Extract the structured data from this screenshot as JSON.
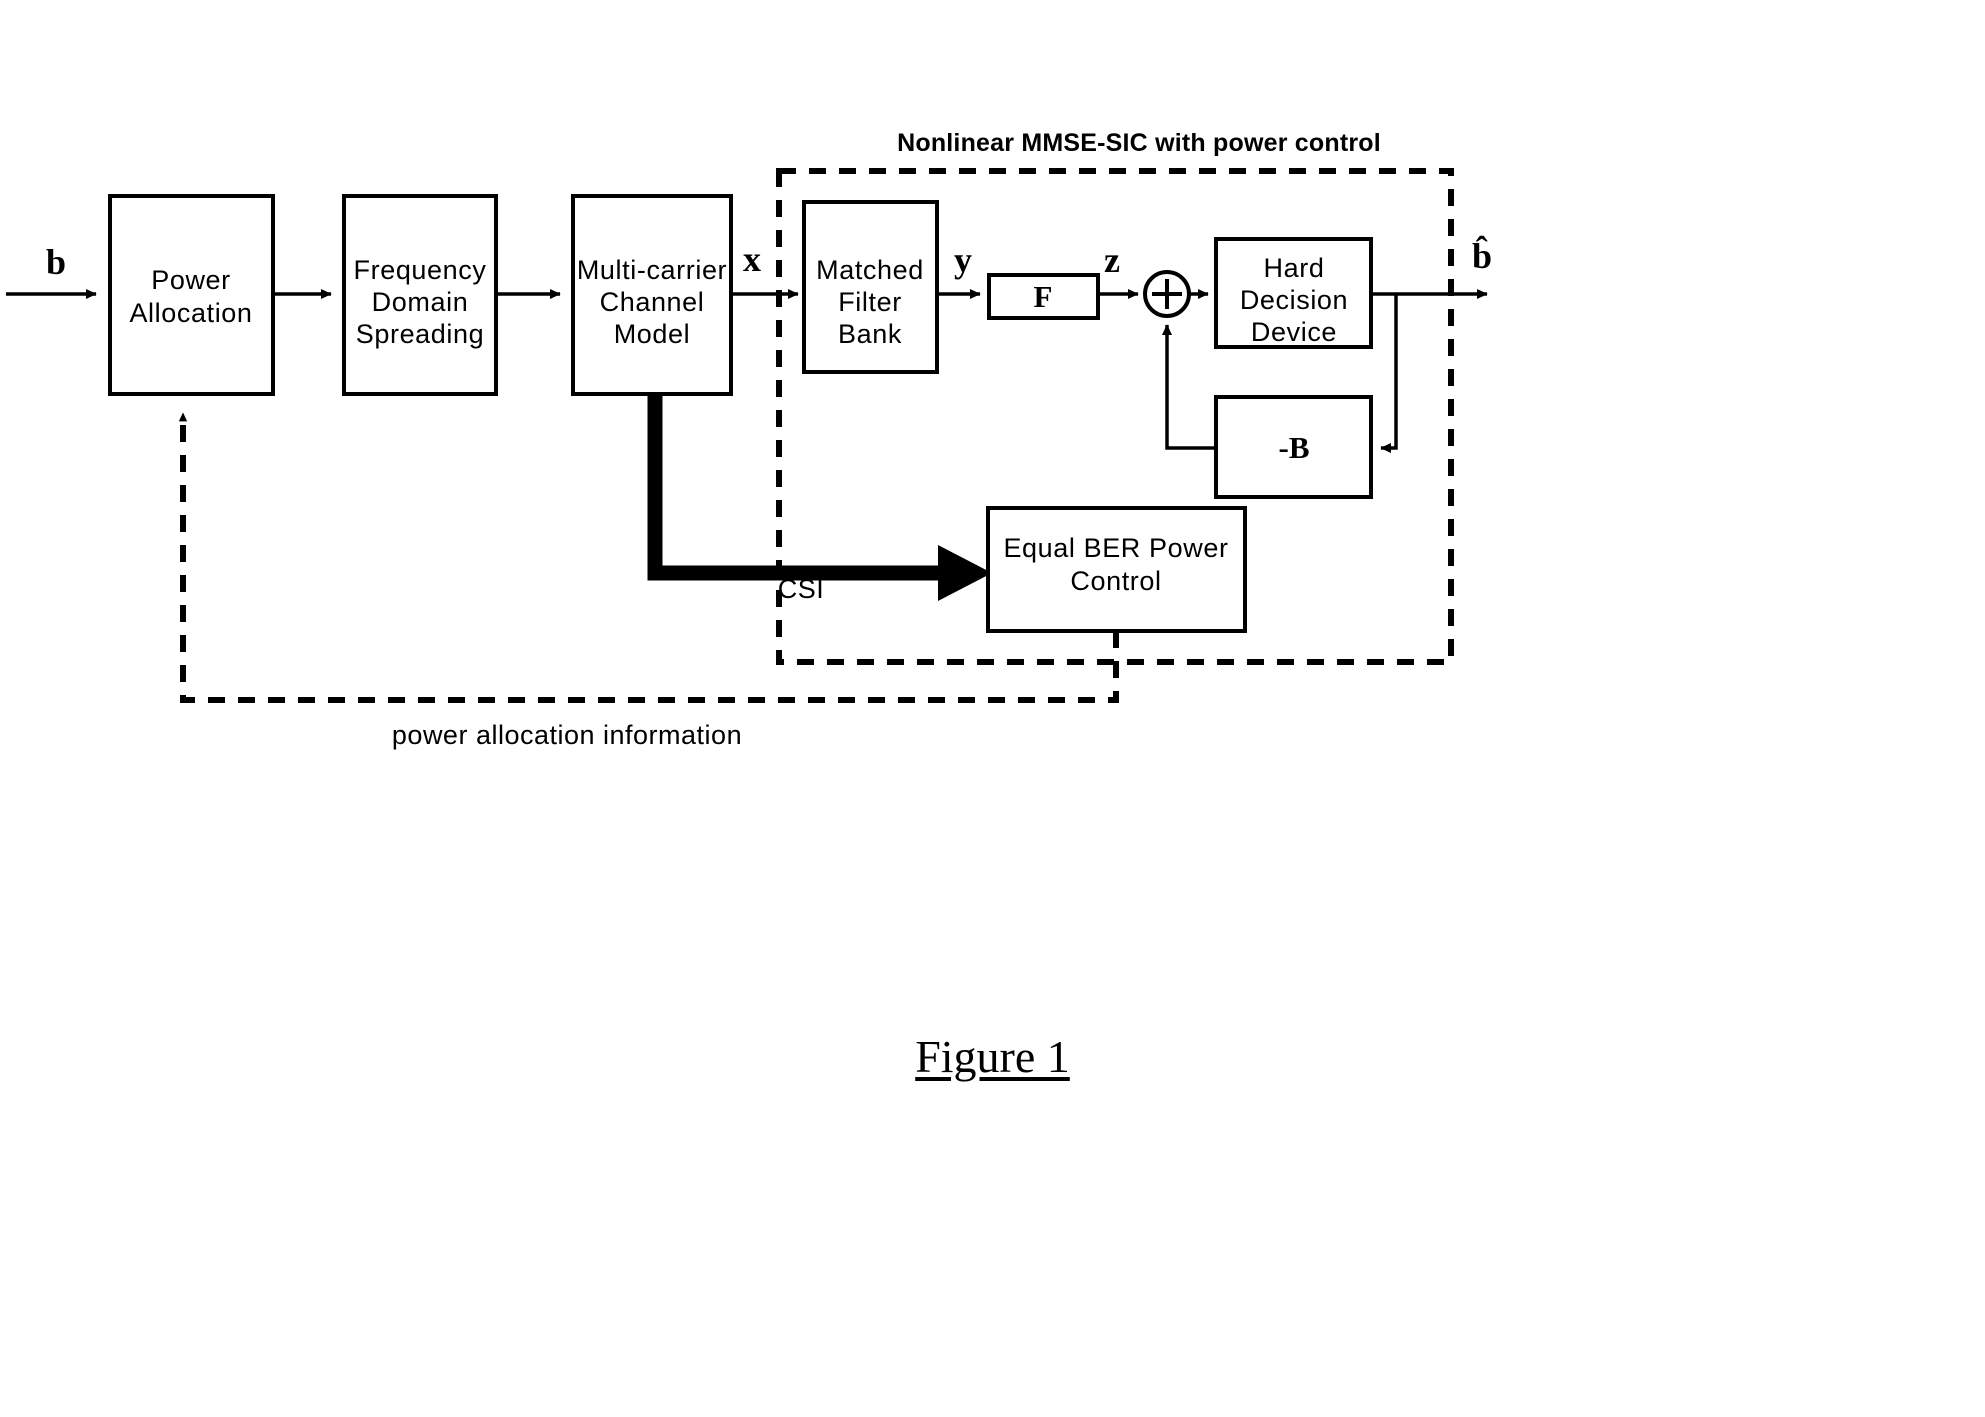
{
  "figure": {
    "caption": "Figure 1",
    "group_box_title": "Nonlinear MMSE-SIC with power control"
  },
  "blocks": [
    {
      "id": "power-allocation",
      "lines": [
        "Power",
        "Allocation"
      ]
    },
    {
      "id": "frequency-domain-spreading",
      "lines": [
        "Frequency",
        "Domain",
        "Spreading"
      ]
    },
    {
      "id": "multicarrier-channel-model",
      "lines": [
        "Multi-carrier",
        "Channel",
        "Model"
      ]
    },
    {
      "id": "matched-filter-bank",
      "lines": [
        "Matched",
        "Filter",
        "Bank"
      ]
    },
    {
      "id": "filter-f",
      "lines": [
        "F"
      ]
    },
    {
      "id": "hard-decision-device",
      "lines": [
        "Hard",
        "Decision",
        "Device"
      ]
    },
    {
      "id": "feedback-b",
      "lines": [
        "-B"
      ]
    },
    {
      "id": "equal-ber-power-control",
      "lines": [
        "Equal BER Power",
        "Control"
      ]
    }
  ],
  "signals": {
    "input": "b",
    "x": "x",
    "y": "y",
    "z": "z",
    "output": "b̂"
  },
  "edge_labels": {
    "csi": "CSI",
    "power_allocation_information": "power allocation information"
  },
  "colors": {
    "ink": "#000000",
    "background": "#ffffff"
  }
}
